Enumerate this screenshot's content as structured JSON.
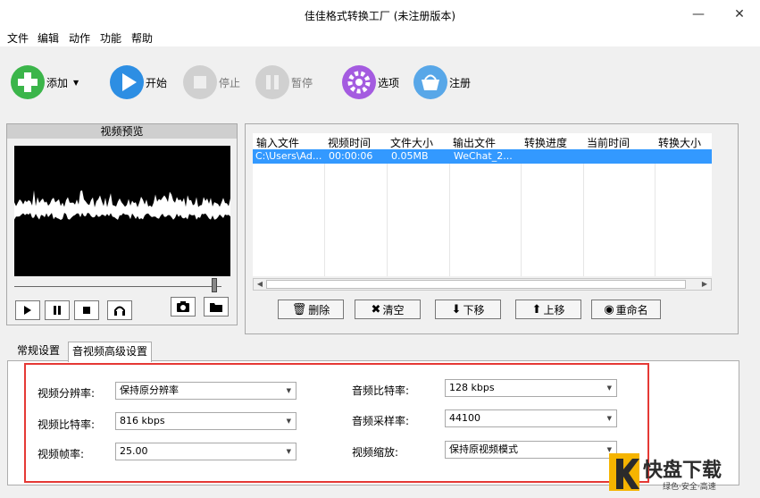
{
  "window": {
    "title": "佳佳格式转换工厂 (未注册版本)"
  },
  "menu": [
    "文件",
    "编辑",
    "动作",
    "功能",
    "帮助"
  ],
  "toolbar": [
    {
      "label": "添加",
      "icon": "plus-icon",
      "color": "#3bb54a",
      "has_dropdown": true
    },
    {
      "label": "开始",
      "icon": "play-icon",
      "color": "#2d8ee3"
    },
    {
      "label": "停止",
      "icon": "stop-icon",
      "color": "#c8c8c8",
      "disabled": true
    },
    {
      "label": "暂停",
      "icon": "pause-icon",
      "color": "#c8c8c8",
      "disabled": true
    },
    {
      "label": "选项",
      "icon": "gear-icon",
      "color": "#a45be0"
    },
    {
      "label": "注册",
      "icon": "basket-icon",
      "color": "#58a7e8"
    }
  ],
  "preview": {
    "title": "视频预览"
  },
  "file_list": {
    "columns": [
      "输入文件",
      "视频时间",
      "文件大小",
      "输出文件",
      "转换进度",
      "当前时间",
      "转换大小"
    ],
    "rows": [
      [
        "C:\\Users\\Ad...",
        "00:00:06",
        "0.05MB",
        "WeChat_2...",
        "",
        "",
        ""
      ]
    ]
  },
  "list_actions": [
    "删除",
    "清空",
    "下移",
    "上移",
    "重命名"
  ],
  "tabs": [
    "常规设置",
    "音视频高级设置"
  ],
  "settings": {
    "left": [
      {
        "label": "视频分辨率:",
        "value": "保持原分辨率"
      },
      {
        "label": "视频比特率:",
        "value": "816 kbps"
      },
      {
        "label": "视频帧率:",
        "value": "25.00"
      }
    ],
    "right": [
      {
        "label": "音频比特率:",
        "value": "128 kbps"
      },
      {
        "label": "音频采样率:",
        "value": "44100"
      },
      {
        "label": "视频缩放:",
        "value": "保持原视频模式"
      }
    ]
  },
  "watermark": {
    "brand": "K快盘下载",
    "slogan": "绿色·安全·高速"
  },
  "colors": {
    "selection": "#3399ff",
    "highlight_border": "#e53935"
  }
}
